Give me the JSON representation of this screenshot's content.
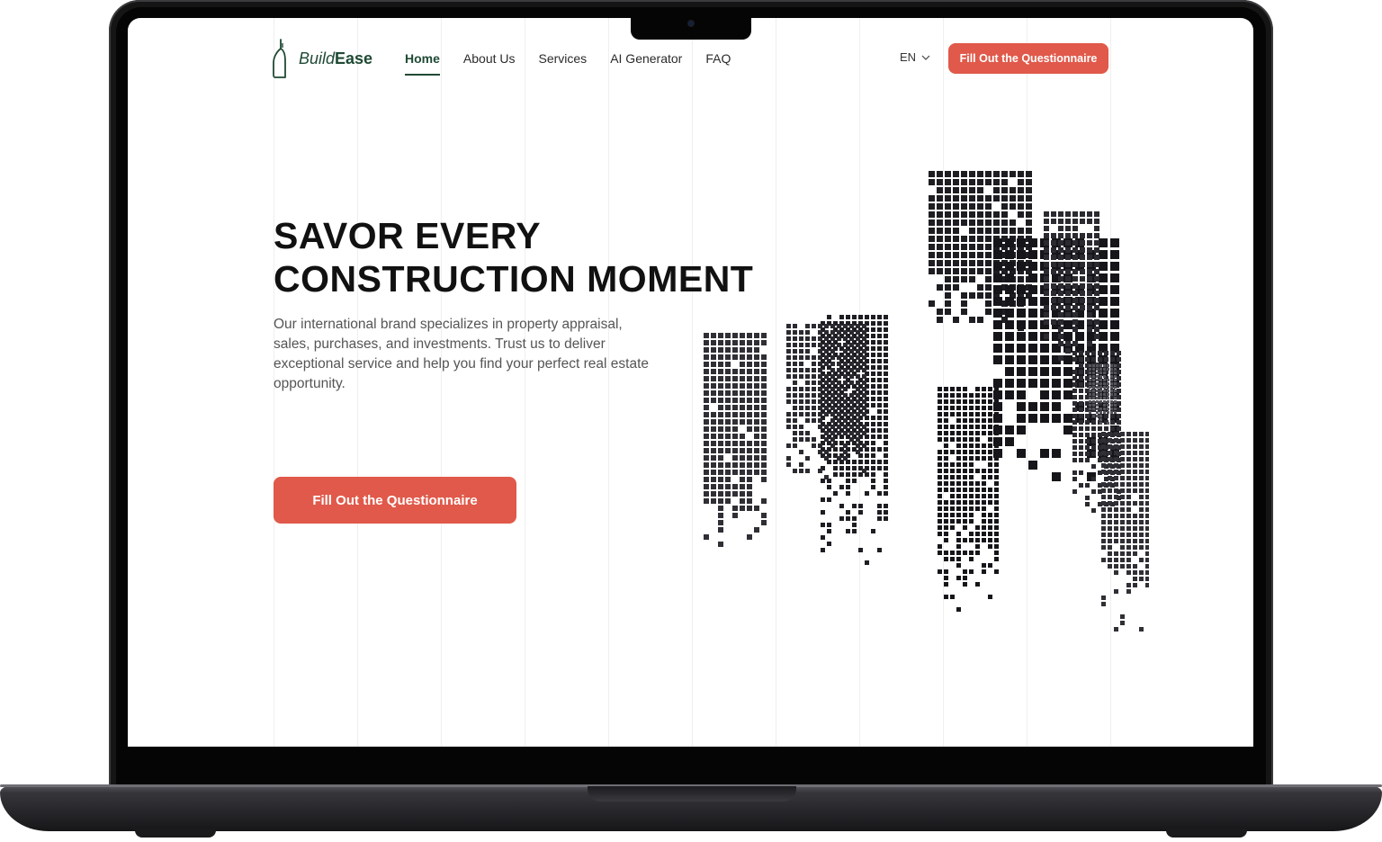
{
  "device": {
    "frame_color": "#151515",
    "screen_color": "#ffffff"
  },
  "brand": {
    "name_light": "Build",
    "name_bold": "Ease",
    "color": "#1f4a34",
    "icon": "building-logo-icon"
  },
  "nav": {
    "items": [
      {
        "label": "Home",
        "active": true
      },
      {
        "label": "About Us",
        "active": false
      },
      {
        "label": "Services",
        "active": false
      },
      {
        "label": "AI Generator",
        "active": false
      },
      {
        "label": "FAQ",
        "active": false
      }
    ]
  },
  "language": {
    "selected": "EN",
    "icon": "chevron-down-icon"
  },
  "header_cta": {
    "label": "Fill Out the Questionnaire"
  },
  "hero": {
    "title_line_1": "SAVOR EVERY",
    "title_line_2": "CONSTRUCTION MOMENT",
    "description": "Our international brand specializes in property appraisal, sales, purchases, and investments. Trust us to deliver exceptional service and help you find your perfect real estate opportunity.",
    "cta_label": "Fill Out the Questionnaire",
    "illustration": "pixel-skyscrapers-illustration"
  },
  "colors": {
    "accent": "#e0594a",
    "text_dark": "#111111",
    "text_body": "#555555",
    "brand_green": "#1f4a34"
  }
}
